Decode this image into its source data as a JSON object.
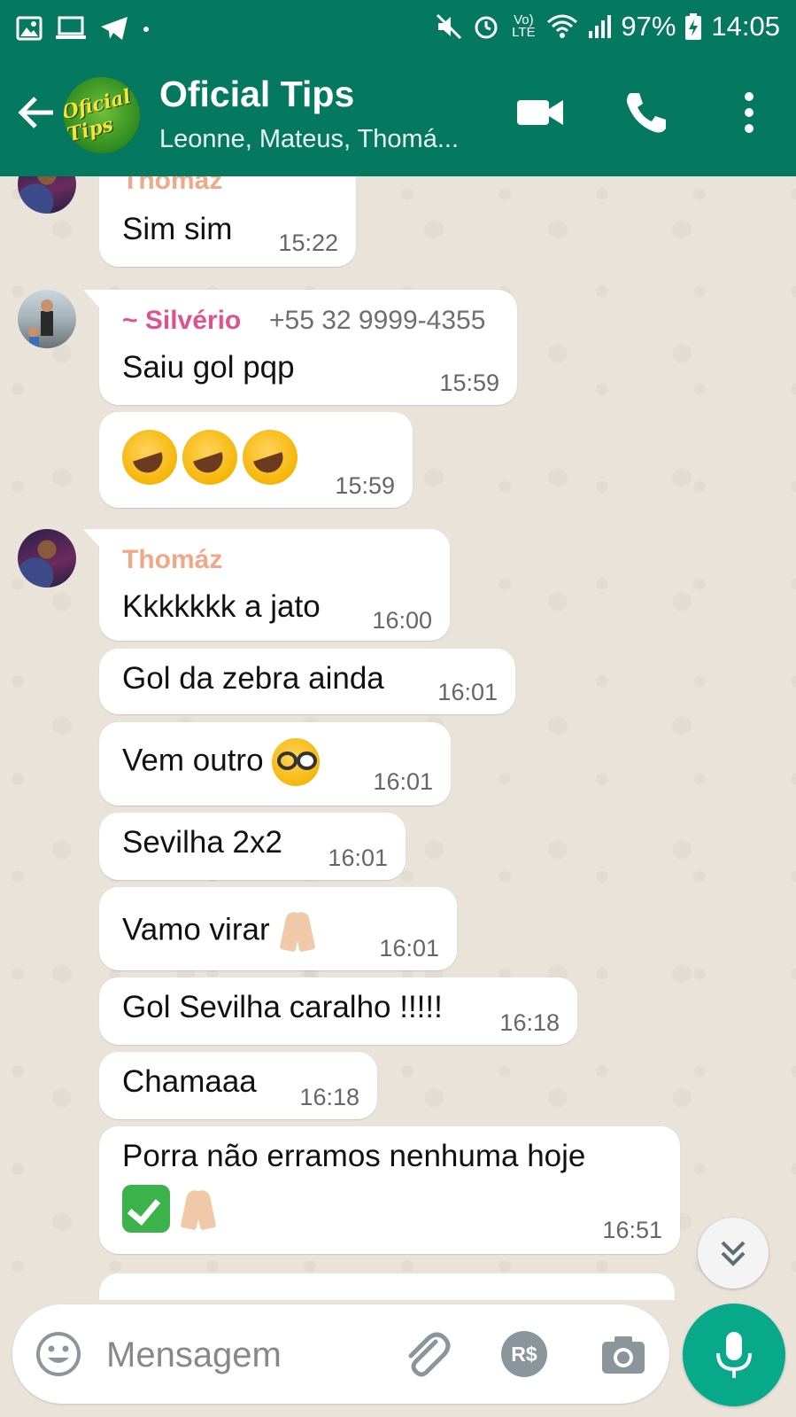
{
  "status_bar": {
    "battery": "97%",
    "time": "14:05",
    "network": "Vo) LTE"
  },
  "header": {
    "avatar_text": "Oficial Tips",
    "title": "Oficial Tips",
    "subtitle": "Leonne, Mateus, Thomá..."
  },
  "messages": [
    {
      "sender": "Thomáz",
      "text": "Sim sim",
      "time": "15:22"
    },
    {
      "sender": "~ Silvério",
      "phone": "+55 32 9999-4355",
      "text": "Saiu gol pqp",
      "time": "15:59"
    },
    {
      "text": "",
      "time": "15:59"
    },
    {
      "sender": "Thomáz",
      "text": "Kkkkkkk a jato",
      "time": "16:00"
    },
    {
      "text": "Gol da zebra ainda",
      "time": "16:01"
    },
    {
      "text": "Vem outro",
      "time": "16:01"
    },
    {
      "text": "Sevilha 2x2",
      "time": "16:01"
    },
    {
      "text": "Vamo virar",
      "time": "16:01"
    },
    {
      "text": "Gol Sevilha caralho !!!!!",
      "time": "16:18"
    },
    {
      "text": "Chamaaa",
      "time": "16:18"
    },
    {
      "text": "Porra não erramos nenhuma hoje",
      "time": "16:51"
    }
  ],
  "colors": {
    "header_bg": "#04795f",
    "mic_bg": "#07a98a",
    "sender_thomaz": "#f0a889",
    "sender_silverio": "#e0528f",
    "chat_bg": "#e9e3da"
  },
  "composer": {
    "placeholder": "Mensagem",
    "currency_label": "R$"
  },
  "icons": [
    "back-arrow-icon",
    "video-call-icon",
    "phone-call-icon",
    "more-vert-icon",
    "emoji-icon",
    "attach-icon",
    "camera-icon",
    "mic-icon",
    "scroll-down-icon"
  ]
}
